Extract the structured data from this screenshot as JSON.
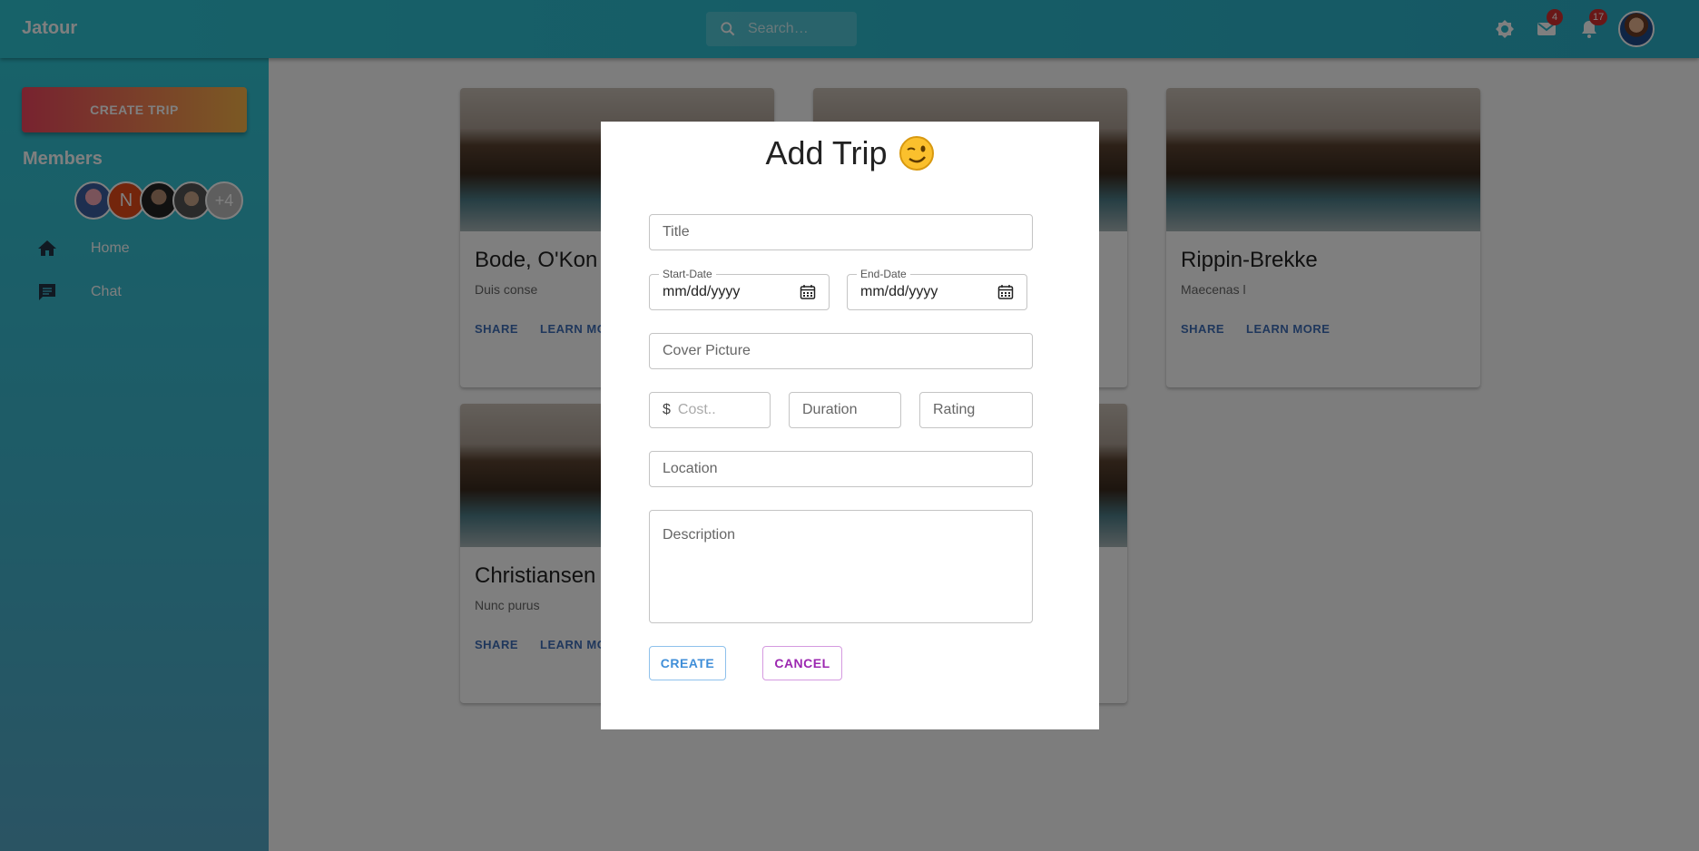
{
  "app": {
    "brand": "Jatour"
  },
  "header": {
    "search_placeholder": "Search…",
    "mail_badge": "4",
    "notifications_badge": "17"
  },
  "sidebar": {
    "create_trip_label": "CREATE TRIP",
    "members_title": "Members",
    "member_initial": "N",
    "more_members": "+4",
    "nav": [
      {
        "label": "Home",
        "icon": "home-icon"
      },
      {
        "label": "Chat",
        "icon": "chat-icon"
      }
    ]
  },
  "cards": [
    {
      "title": "Bode, O'Kon a",
      "text": "Duis conse",
      "share": "SHARE",
      "learn": "LEARN MORE"
    },
    {
      "title": "Rippin-Brekke",
      "text": "Maecenas l",
      "share": "SHARE",
      "learn": "LEARN MORE"
    },
    {
      "title": "Christiansen",
      "text": "Nunc purus",
      "share": "SHARE",
      "learn": "LEARN MORE"
    }
  ],
  "modal": {
    "title": "Add Trip",
    "title_placeholder": "Title",
    "start_date_label": "Start-Date",
    "end_date_label": "End-Date",
    "date_placeholder": "mm/dd/yyyy",
    "cover_placeholder": "Cover Picture",
    "currency_symbol": "$",
    "cost_placeholder": "Cost..",
    "duration_placeholder": "Duration",
    "rating_placeholder": "Rating",
    "location_placeholder": "Location",
    "description_placeholder": "Description",
    "create_label": "CREATE",
    "cancel_label": "CANCEL"
  },
  "colors": {
    "brand_teal": "#2fc4d3",
    "create_gradient_start": "#f0465f",
    "create_gradient_end": "#f7b348",
    "create_button": "#3f8ed8",
    "cancel_button": "#9c27b0"
  }
}
